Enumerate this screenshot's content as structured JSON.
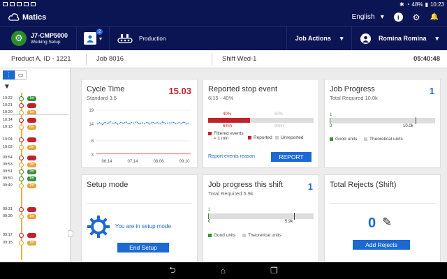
{
  "status_bar": {
    "battery": "48%",
    "time": "10:23"
  },
  "app": {
    "name": "Matics",
    "language": "English"
  },
  "machine": {
    "name": "J7-CMP5000",
    "state": "Working Setup"
  },
  "nav": {
    "notification_count": "2",
    "production_label": "Production",
    "job_actions": "Job Actions",
    "user": "Romina Romina"
  },
  "info": {
    "product": "Product  A, ID - 1221",
    "job": "Job  8016",
    "shift": "Shift  Wed-1",
    "time": "05:40:48"
  },
  "timeline": [
    {
      "time": "10:22",
      "tag": "1m",
      "color": "green"
    },
    {
      "time": "10:21",
      "tag": "1m",
      "color": "red"
    },
    {
      "time": "10:20",
      "tag": "1m",
      "color": "orange"
    },
    {
      "time": "10:14",
      "tag": "1m",
      "color": "red"
    },
    {
      "time": "10:13",
      "tag": "6m",
      "color": "orange"
    },
    {
      "time": "10:04",
      "tag": "2m",
      "color": "red"
    },
    {
      "time": "10:02",
      "tag": "2m",
      "color": "orange"
    },
    {
      "time": "09:54",
      "tag": "1m",
      "color": "red"
    },
    {
      "time": "09:53",
      "tag": "2m",
      "color": "orange"
    },
    {
      "time": "09:51",
      "tag": "2m",
      "color": "green"
    },
    {
      "time": "09:50",
      "tag": "1m",
      "color": "green"
    },
    {
      "time": "09:49",
      "tag": "1m",
      "color": "orange"
    },
    {
      "time": "09:31",
      "tag": "1m",
      "color": "red"
    },
    {
      "time": "09:30",
      "tag": "1m",
      "color": "orange"
    },
    {
      "time": "09:17",
      "tag": "2m",
      "color": "red"
    },
    {
      "time": "09:15",
      "tag": "1m",
      "color": "orange"
    }
  ],
  "cycle_time": {
    "title": "Cycle Time",
    "standard": "Standard 3.5",
    "value": "15.03",
    "chart_data": {
      "type": "line",
      "yticks": [
        "19",
        "14",
        "8",
        "3"
      ],
      "xticks": [
        "06:14",
        "07:14",
        "08:06",
        "09:10"
      ],
      "ylim": [
        3,
        19
      ],
      "series": [
        {
          "values": [
            14,
            14.6,
            13.8,
            14.8,
            14.1,
            14.9,
            14.2,
            14.6,
            13.9,
            14.7,
            14.3,
            14.8,
            14.0,
            14.6,
            14.4,
            14.9,
            14.1,
            14.5,
            14.2,
            14.7,
            14.0,
            14.8,
            14.3,
            14.6,
            14.1,
            14.9,
            14.2,
            14.5,
            14.4,
            14.7,
            14.1,
            14.6,
            14.3,
            14.8,
            14.0,
            14.6
          ]
        }
      ]
    }
  },
  "reported_stop": {
    "title": "Reported stop event",
    "subtitle": "6/15 - 40%",
    "reported_pct": "40%",
    "unreported_pct": "60%",
    "reported_fraction": 0.4,
    "min_label": "6min",
    "max_label": "9min",
    "legend_filtered": "Filtered events",
    "legend_filtered2": "< 1 min",
    "legend_reported": "Reported",
    "legend_unreported": "Unreported",
    "link": "Report events reason",
    "button": "REPORT"
  },
  "job_progress": {
    "title": "Job Progress",
    "subtitle": "Total Required 10.0k",
    "value": "1",
    "start": "1",
    "zero": "0",
    "end": "10.0k",
    "fraction": 0.0001,
    "legend_good": "Good units",
    "legend_theoretical": "Theoretical units"
  },
  "setup_mode": {
    "title": "Setup mode",
    "message": "You are in setup mode",
    "button": "End Setup"
  },
  "job_progress_shift": {
    "title": "Job progress this shift",
    "subtitle": "Total Required 5.9k",
    "value": "1",
    "start": "1",
    "zero": "0",
    "end": "5.9k",
    "fraction": 0.0002,
    "legend_good": "Good units",
    "legend_theoretical": "Theoretical units"
  },
  "total_rejects": {
    "title": "Total Rejects (Shift)",
    "value": "0",
    "button": "Add Rejects"
  },
  "colors": {
    "navy": "#0b1554",
    "accent": "#1c69d3",
    "red": "#c0232b",
    "green": "#3a8f3a"
  }
}
